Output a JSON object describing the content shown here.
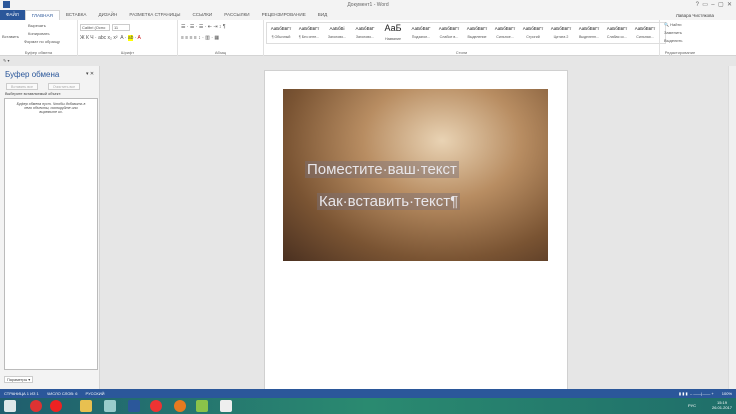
{
  "window": {
    "title": "Документ1 - Word",
    "user": "Лавара Чистякова"
  },
  "tabs": [
    "ФАЙЛ",
    "ГЛАВНАЯ",
    "ВСТАВКА",
    "ДИЗАЙН",
    "РАЗМЕТКА СТРАНИЦЫ",
    "ССЫЛКИ",
    "РАССЫЛКИ",
    "РЕЦЕНЗИРОВАНИЕ",
    "ВИД"
  ],
  "ribbon": {
    "clipboard": {
      "paste": "Вставить",
      "cut": "Вырезать",
      "copy": "Копировать",
      "format": "Формат по образцу",
      "label": "Буфер обмена"
    },
    "font": {
      "name": "Calibri (Осно",
      "size": "11",
      "label": "Шрифт"
    },
    "paragraph": {
      "label": "Абзац"
    },
    "styles": {
      "label": "Стили",
      "items": [
        {
          "preview": "АаБбВвГг",
          "name": "¶ Обычный"
        },
        {
          "preview": "АаБбВвГг",
          "name": "¶ Без инте..."
        },
        {
          "preview": "АаБбВі",
          "name": "Заголово..."
        },
        {
          "preview": "АаБбВвГ",
          "name": "Заголово..."
        },
        {
          "preview": "АаБ",
          "name": "Название"
        },
        {
          "preview": "АаБбВвГ",
          "name": "Подзагол..."
        },
        {
          "preview": "АаБбВвГг",
          "name": "Слабое в..."
        },
        {
          "preview": "АаБбВвГг",
          "name": "Выделение"
        },
        {
          "preview": "АаБбВвГг",
          "name": "Сильное..."
        },
        {
          "preview": "АаБбВвГг",
          "name": "Строгий"
        },
        {
          "preview": "АаБбВвГг",
          "name": "Цитата 2"
        },
        {
          "preview": "АаБбВвГг",
          "name": "Выделенн..."
        },
        {
          "preview": "АаБбВвГг",
          "name": "Слабая сс..."
        },
        {
          "preview": "АаБбВвГг",
          "name": "Сильная..."
        }
      ]
    },
    "editing": {
      "find": "Найти",
      "replace": "Заменить",
      "select": "Выделить",
      "label": "Редактирование"
    }
  },
  "clipboard_pane": {
    "title": "Буфер обмена",
    "paste_all": "Вставить все",
    "clear_all": "Очистить все",
    "prompt": "Выберите вставляемый объект:",
    "empty_text": "Буфер обмена пуст. Чтобы добавить в него объекты, скопируйте или вырежьте их.",
    "options": "Параметры"
  },
  "document": {
    "line1": "Поместите·ваш·текст",
    "line2": "Как·вставить·текст¶"
  },
  "status": {
    "page": "СТРАНИЦА 1 ИЗ 1",
    "words": "ЧИСЛО СЛОВ: 6",
    "lang": "РУССКИЙ",
    "zoom": "100%"
  },
  "taskbar": {
    "lang": "РУС",
    "time": "15:19",
    "date": "26.01.2017"
  }
}
